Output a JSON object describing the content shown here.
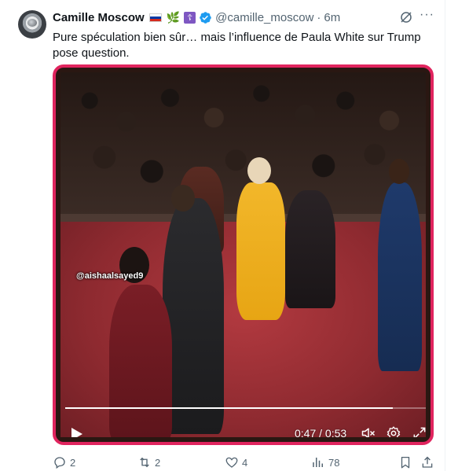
{
  "tweet": {
    "author_name": "Camille Moscow",
    "badges": [
      "flag-russia-icon",
      "olive-branch-icon",
      "orthodox-cross-icon",
      "verified-icon"
    ],
    "olive_emoji": "🌿",
    "cross_glyph": "☦",
    "handle": "@camille_moscow",
    "separator": "·",
    "time": "6m",
    "text": "Pure spéculation bien sûr… mais l’influence de Paula White sur Trump pose question."
  },
  "media": {
    "watermark": "@aishaalsayed9",
    "current_time": "0:47",
    "duration": "0:53",
    "time_readout": "0:47 / 0:53",
    "progress": 0.897,
    "border_color": "#e0245e"
  },
  "actions": {
    "replies": "2",
    "reposts": "2",
    "likes": "4",
    "views": "78"
  },
  "colors": {
    "text": "#0f1419",
    "secondary": "#536471",
    "verified": "#1d9bf0"
  }
}
